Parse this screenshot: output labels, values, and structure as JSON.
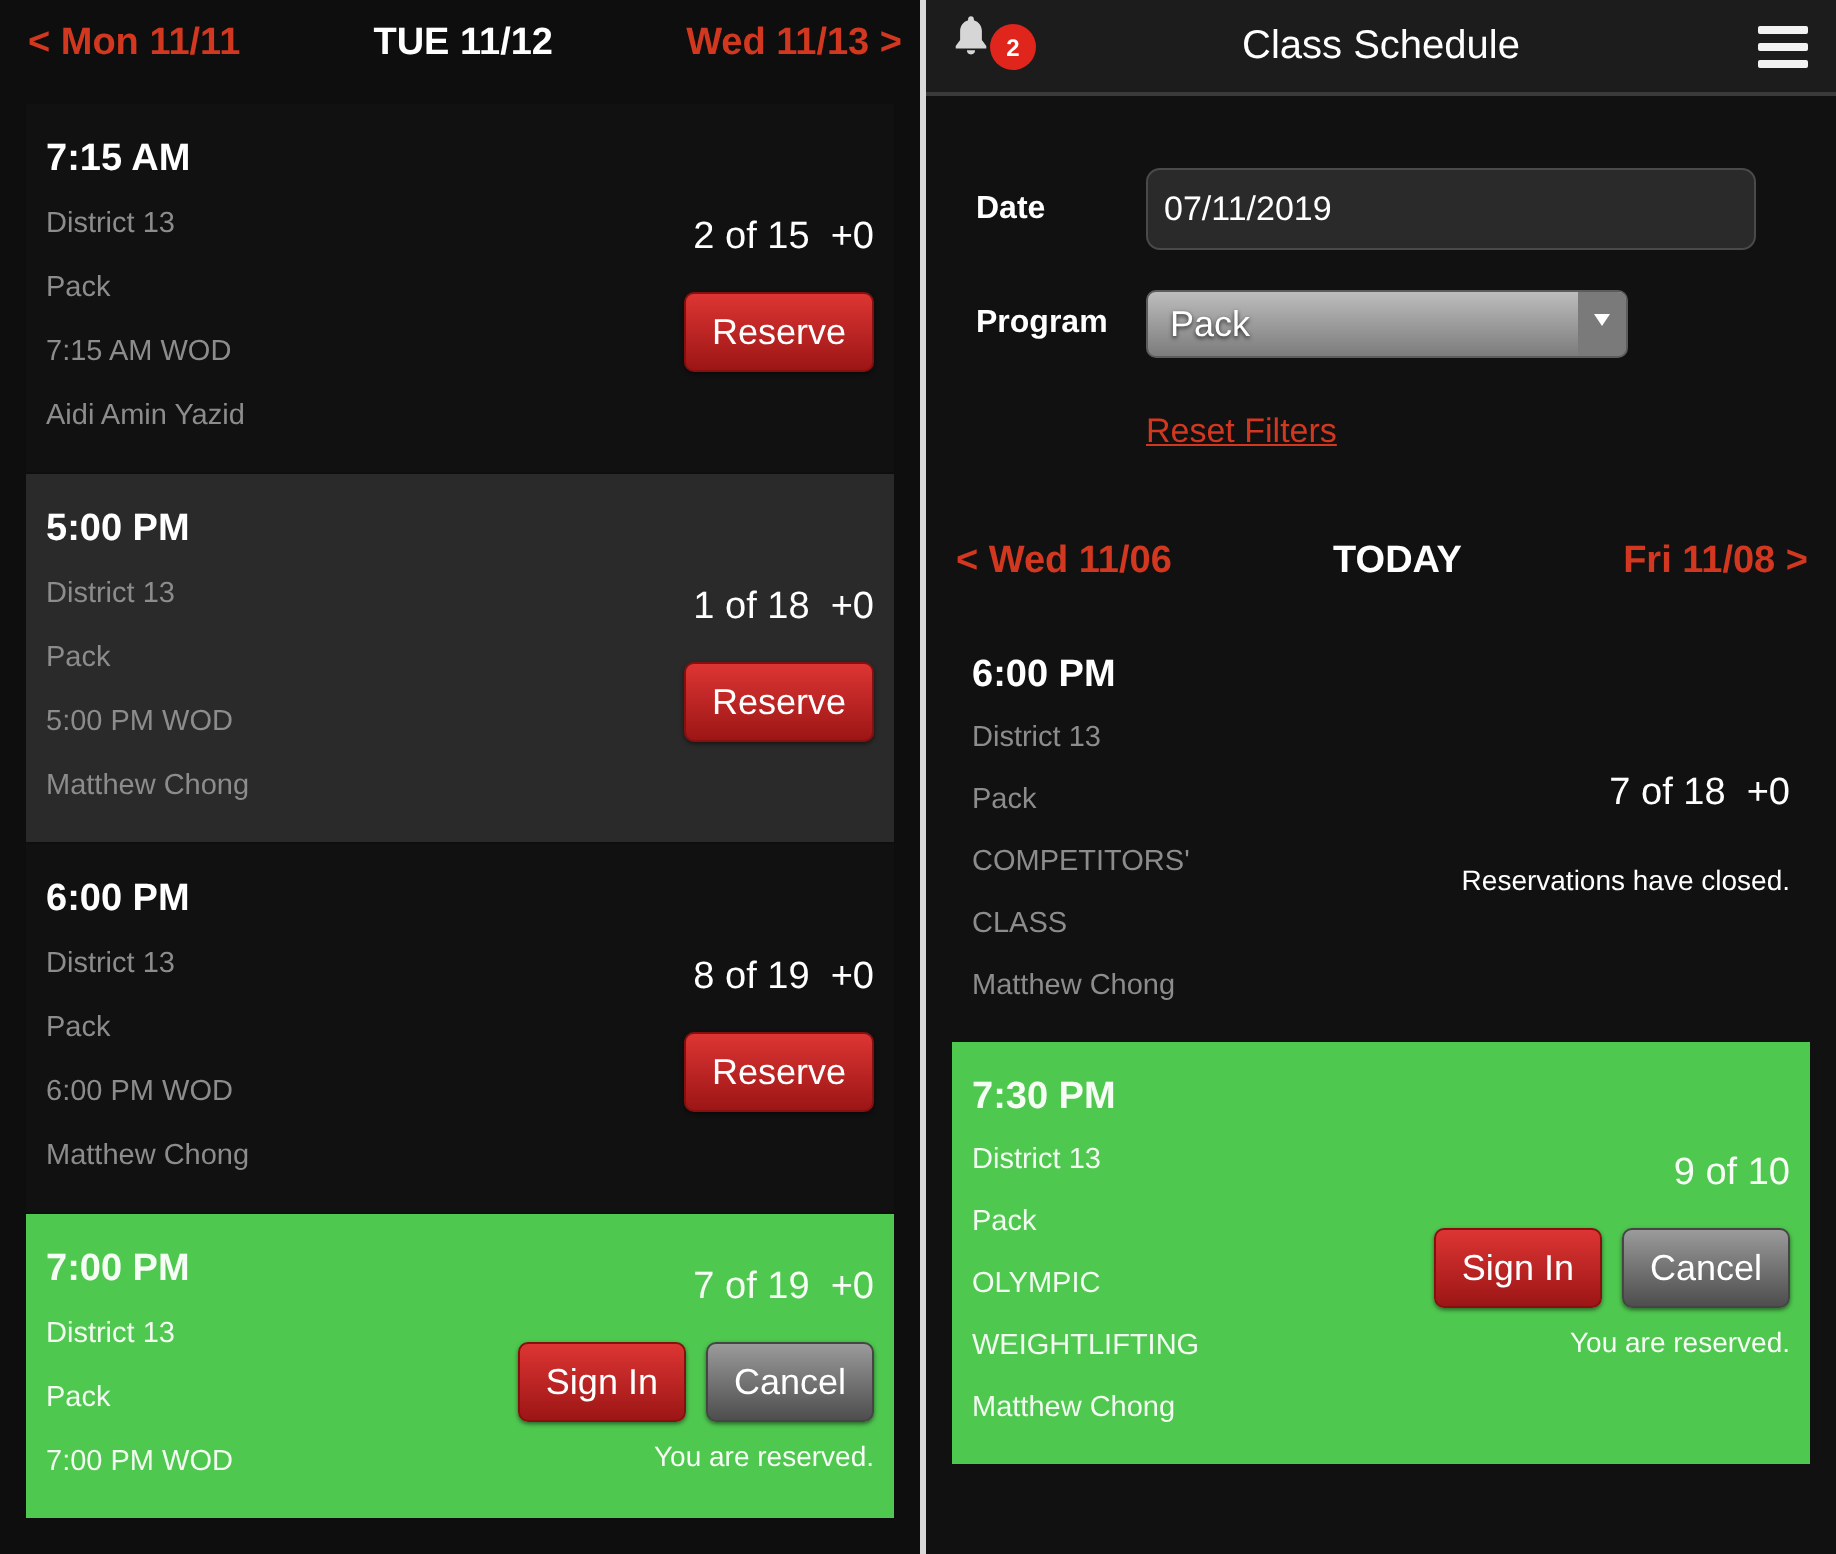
{
  "left_panel": {
    "day_nav": {
      "previous": "< Mon 11/11",
      "current": "TUE 11/12",
      "next": "Wed 11/13 >"
    },
    "classes": [
      {
        "time": "7:15 AM",
        "location": "District 13",
        "program": "Pack",
        "class_name": "7:15 AM WOD",
        "coach": "Aidi Amin Yazid",
        "count": "2 of 15  +0",
        "selected": false,
        "reserved": false,
        "buttons": [
          {
            "kind": "reserve",
            "label": "Reserve"
          }
        ]
      },
      {
        "time": "5:00 PM",
        "location": "District 13",
        "program": "Pack",
        "class_name": "5:00 PM WOD",
        "coach": "Matthew Chong",
        "count": "1 of 18  +0",
        "selected": true,
        "reserved": false,
        "buttons": [
          {
            "kind": "reserve",
            "label": "Reserve"
          }
        ]
      },
      {
        "time": "6:00 PM",
        "location": "District 13",
        "program": "Pack",
        "class_name": "6:00 PM WOD",
        "coach": "Matthew Chong",
        "count": "8 of 19  +0",
        "selected": false,
        "reserved": false,
        "buttons": [
          {
            "kind": "reserve",
            "label": "Reserve"
          }
        ]
      },
      {
        "time": "7:00 PM",
        "location": "District 13",
        "program": "Pack",
        "class_name": "7:00 PM WOD",
        "count": "7 of 19  +0",
        "selected": false,
        "reserved": true,
        "buttons": [
          {
            "kind": "sign_in",
            "label": "Sign In"
          },
          {
            "kind": "cancel",
            "label": "Cancel"
          }
        ],
        "note": "You are reserved."
      }
    ]
  },
  "right_panel": {
    "header": {
      "title": "Class Schedule",
      "notification_count": "2"
    },
    "filters": {
      "date": {
        "label": "Date",
        "value": "07/11/2019"
      },
      "program": {
        "label": "Program",
        "value": "Pack"
      },
      "reset_link": "Reset Filters"
    },
    "day_nav": {
      "previous": "< Wed 11/06",
      "current": "TODAY",
      "next": "Fri 11/08 >"
    },
    "classes": [
      {
        "time": "6:00 PM",
        "location": "District 13",
        "program": "Pack",
        "class_name": "COMPETITORS' CLASS",
        "coach": "Matthew Chong",
        "count": "7 of 18  +0",
        "selected": false,
        "reserved": false,
        "note": "Reservations have closed."
      },
      {
        "time": "7:30 PM",
        "location": "District 13",
        "program": "Pack",
        "class_name": "OLYMPIC WEIGHTLIFTING",
        "coach": "Matthew Chong",
        "count": "9 of 10",
        "selected": false,
        "reserved": true,
        "buttons": [
          {
            "kind": "sign_in",
            "label": "Sign In"
          },
          {
            "kind": "cancel",
            "label": "Cancel"
          }
        ],
        "note": "You are reserved."
      }
    ]
  }
}
